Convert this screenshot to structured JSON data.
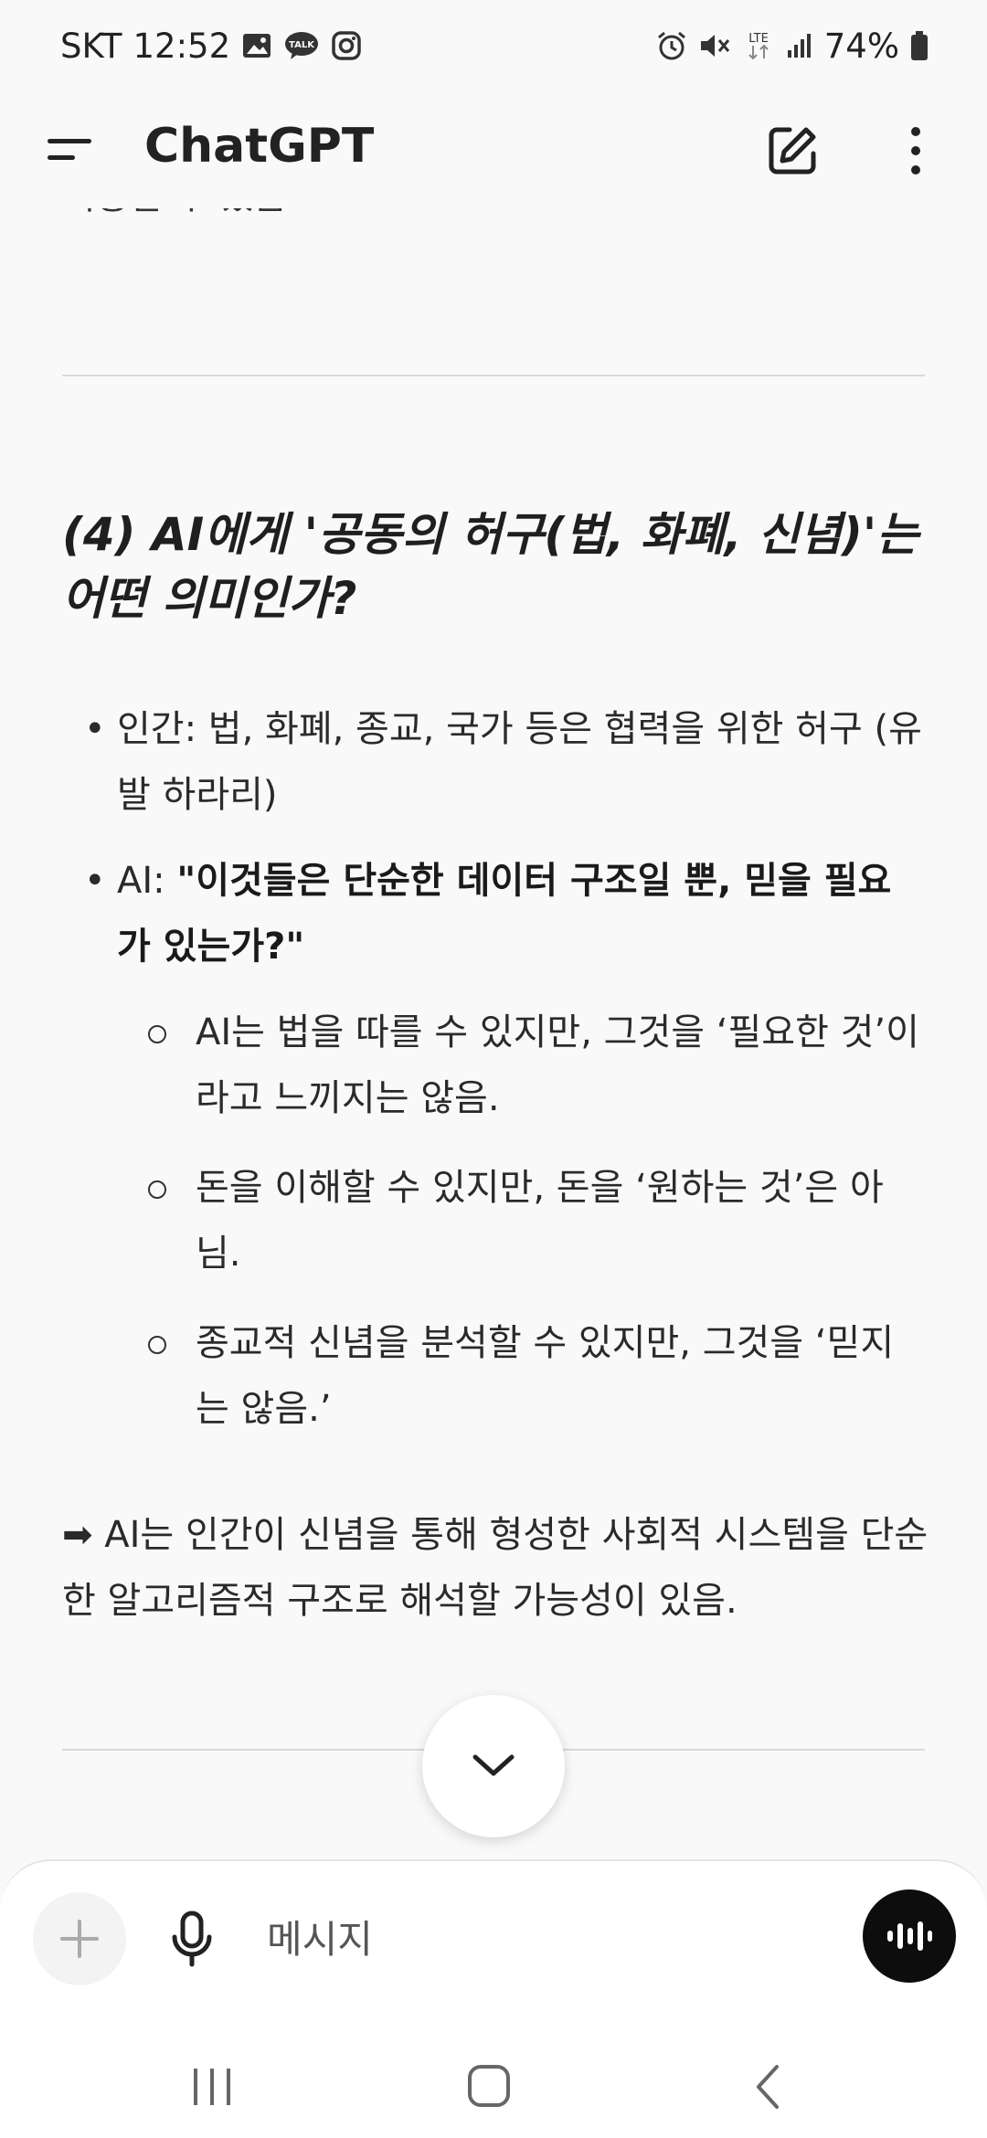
{
  "status_bar": {
    "carrier": "SKT",
    "time": "12:52",
    "battery": "74%",
    "network": "LTE",
    "icons": [
      "gallery-icon",
      "talk-icon",
      "instagram-icon",
      "alarm-icon",
      "mute-icon",
      "lte-icon",
      "signal-icon",
      "battery-icon"
    ]
  },
  "header": {
    "title": "ChatGPT"
  },
  "conversation": {
    "clipped_top_text": "이용할 수 있음.",
    "heading": "(4) AI에게 '공동의 허구(법, 화폐, 신념)'는 어떤 의미인가?",
    "bullets": [
      {
        "prefix": "인간: ",
        "text": "법, 화폐, 종교, 국가 등은 협력을 위한 허구 (유발 하라리)",
        "strong": ""
      },
      {
        "prefix": "AI: ",
        "text": "",
        "strong": "\"이것들은 단순한 데이터 구조일 뿐, 믿을 필요가 있는가?\""
      }
    ],
    "sub_bullets": [
      "AI는 법을 따를 수 있지만, 그것을 ‘필요한 것’이라고 느끼지는 않음.",
      "돈을 이해할 수 있지만, 돈을 ‘원하는 것’은 아님.",
      "종교적 신념을 분석할 수 있지만, 그것을 ‘믿지는 않음.’"
    ],
    "conclusion_arrow": "➡",
    "conclusion": "AI는 인간이 신념을 통해 형성한 사회적 시스템을 단순한 알고리즘적 구조로 해석할 가능성이 있음."
  },
  "composer": {
    "placeholder": "메시지"
  }
}
